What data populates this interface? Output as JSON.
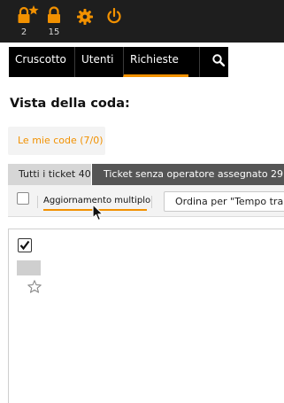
{
  "topbar": {
    "locked_new_count": "2",
    "locked_count": "15",
    "icons": [
      "locked-tickets-new-icon",
      "locked-tickets-icon",
      "gear-icon",
      "power-icon"
    ],
    "accent": "#f29100"
  },
  "nav": {
    "items": [
      "Cruscotto",
      "Utenti",
      "Richieste"
    ],
    "active": "Richieste",
    "search_icon": "search-icon"
  },
  "page": {
    "title": "Vista della coda:"
  },
  "queues": {
    "my_queues_label": "Le mie code (7/0)"
  },
  "tabs": [
    {
      "label": "Tutti i ticket 40",
      "active": true
    },
    {
      "label": "Ticket senza operatore assegnato 29",
      "active": false
    }
  ],
  "toolbar": {
    "bulk_label": "Aggiornamento multiplo",
    "sort_label": "Ordina per \"Tempo tra"
  },
  "list": {
    "row_checked": true,
    "star_icon": "star-outline-icon"
  }
}
